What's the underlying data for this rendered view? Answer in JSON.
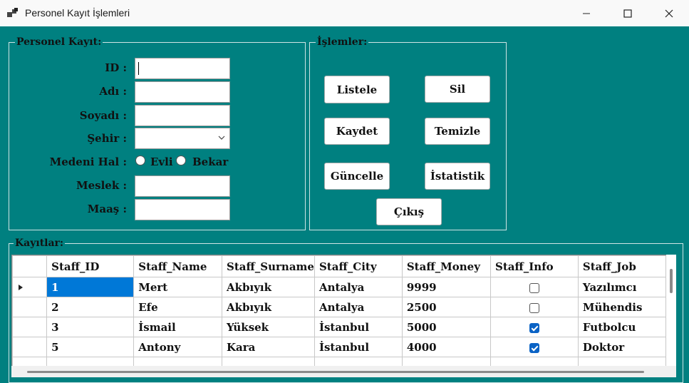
{
  "window": {
    "title": "Personel Kayıt İşlemleri",
    "app_icon": "app-window-icon",
    "controls": [
      "minimize-icon",
      "maximize-icon",
      "close-icon"
    ]
  },
  "form": {
    "legend": "Personel Kayıt:",
    "id_label": "ID :",
    "name_label": "Adı :",
    "surname_label": "Soyadı :",
    "city_label": "Şehir :",
    "marital_label": "Medeni Hal :",
    "married_label": "Evli",
    "single_label": "Bekar",
    "job_label": "Meslek :",
    "salary_label": "Maaş :",
    "id_value": "",
    "name_value": "",
    "surname_value": "",
    "city_value": "",
    "job_value": "",
    "salary_value": ""
  },
  "actions": {
    "legend": "İşlemler:",
    "list": "Listele",
    "delete": "Sil",
    "save": "Kaydet",
    "clear": "Temizle",
    "update": "Güncelle",
    "stats": "İstatistik",
    "exit": "Çıkış"
  },
  "records": {
    "legend": "Kayıtlar:",
    "columns": [
      "Staff_ID",
      "Staff_Name",
      "Staff_Surname",
      "Staff_City",
      "Staff_Money",
      "Staff_Info",
      "Staff_Job"
    ],
    "rows": [
      [
        "1",
        "Mert",
        "Akbıyık",
        "Antalya",
        "9999",
        false,
        "Yazılımcı"
      ],
      [
        "2",
        "Efe",
        "Akbıyık",
        "Antalya",
        "2500",
        false,
        "Mühendis"
      ],
      [
        "3",
        "İsmail",
        "Yüksek",
        "İstanbul",
        "5000",
        true,
        "Futbolcu"
      ],
      [
        "5",
        "Antony",
        "Kara",
        "İstanbul",
        "4000",
        true,
        "Doktor"
      ]
    ],
    "current_row_icon": "current-row-arrow-icon"
  },
  "colors": {
    "background": "#008080",
    "selection": "#0078d7",
    "checkbox": "#0b63c5"
  }
}
